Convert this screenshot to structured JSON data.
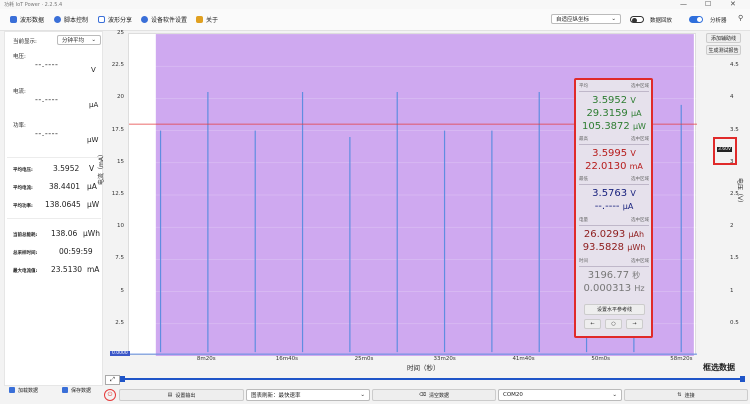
{
  "window": {
    "title": "功耗 IoT Power · 2.2.5.4",
    "controls": [
      "—",
      "☐",
      "✕"
    ]
  },
  "toolbar": {
    "items": [
      {
        "label": "波形数据",
        "color": "#3a6fd8"
      },
      {
        "label": "脚本控制",
        "color": "#3a6fd8"
      },
      {
        "label": "波形分享",
        "color": "#3a6fd8"
      },
      {
        "label": "设备软件设置",
        "color": "#3a6fd8"
      },
      {
        "label": "关于",
        "color": "#e0a020"
      }
    ],
    "range_select": "自适应纵坐标",
    "data_record_label": "数据回放",
    "data_record_on": false,
    "analyze_label": "分析器",
    "analyze_on": true,
    "pin_icon": "pin-icon"
  },
  "left": {
    "display_label": "当前显示:",
    "display_mode": "分钟平均",
    "voltage_label": "电压:",
    "voltage_value": "--.----",
    "voltage_unit": "V",
    "current_label": "电流:",
    "current_value": "--.----",
    "current_unit": "µA",
    "power_label": "功率:",
    "power_value": "--.----",
    "power_unit": "µW",
    "avg_voltage_label": "平均电压:",
    "avg_voltage": "3.5952",
    "avg_voltage_unit": "V",
    "avg_current_label": "平均电流:",
    "avg_current": "38.4401",
    "avg_current_unit": "µA",
    "avg_power_label": "平均功率:",
    "avg_power": "138.0645",
    "avg_power_unit": "µW",
    "total_energy_label": "当前总能耗:",
    "total_energy": "138.06",
    "total_energy_unit": "µWh",
    "run_time_label": "总采样时间:",
    "run_time": "00:59:59",
    "max_current_label": "最大电流值:",
    "max_current": "23.5130",
    "max_current_unit": "mA",
    "load_button": "加载数据",
    "save_button": "保存数据"
  },
  "plot": {
    "ylabel": "电流（mA）",
    "y2label": "电压（V）",
    "xlabel": "时间（秒）",
    "select_label": "框选数据",
    "yticks": [
      "25",
      "22.5",
      "20",
      "17.5",
      "15",
      "12.5",
      "10",
      "7.5",
      "5",
      "2.5"
    ],
    "y2ticks": [
      "4.5",
      "4",
      "3.5",
      "3",
      "2.5",
      "2",
      "1.5",
      "1",
      "0.5"
    ],
    "xticks": [
      "8m20s",
      "16m40s",
      "25m0s",
      "33m20s",
      "41m40s",
      "50m0s",
      "58m20s"
    ],
    "cursor_value": "3.60V",
    "corner_value": "0.0000",
    "side_buttons": [
      "添加辅助线",
      "生成测试报告"
    ],
    "region_color": "#cfa9f0",
    "spike_color": "#5f8de0",
    "hline_color": "#e53b3b"
  },
  "overlay": {
    "avg_title": "平均",
    "avg_right": "选中区域",
    "avg_v": "3.5952",
    "avg_v_unit": "V",
    "avg_i": "29.3159",
    "avg_i_unit": "µA",
    "avg_p": "105.3872",
    "avg_p_unit": "µW",
    "max_title": "最高",
    "max_right": "选中区域",
    "max_v": "3.5995",
    "max_v_unit": "V",
    "max_i": "22.0130",
    "max_i_unit": "mA",
    "min_title": "最低",
    "min_right": "选中区域",
    "min_v": "3.5763",
    "min_v_unit": "V",
    "min_i": "--.----",
    "min_i_unit": "µA",
    "energy_title": "电量",
    "energy_right": "选中区域",
    "charge": "26.0293",
    "charge_unit": "µAh",
    "energy": "93.5828",
    "energy_unit": "µWh",
    "time_title": "时间",
    "time_right": "选中区域",
    "duration": "3196.77",
    "duration_unit": "秒",
    "freq": "0.000313",
    "freq_unit": "Hz",
    "set_ref_button": "设置水平参考线",
    "nav_left": "←",
    "nav_center": "○",
    "nav_right": "→"
  },
  "bottom": {
    "set_output": "设置输出",
    "rate_select": "图表刷新：最快速率",
    "clear_data": "清空数据",
    "port_select": "COM20",
    "connect": "连接"
  },
  "chart_data": {
    "type": "line",
    "xlabel": "时间（秒）",
    "ylabel": "电流（mA）",
    "y2label": "电压（V）",
    "xlim": [
      0,
      3600
    ],
    "ylim": [
      0,
      25
    ],
    "y2lim": [
      0,
      5
    ],
    "series": [
      {
        "x": [
          200,
          500,
          800,
          1100,
          1400,
          1700,
          2000,
          2300,
          2600,
          2900,
          3200,
          3500
        ],
        "values": [
          17.5,
          20.5,
          17.5,
          20.5,
          17.0,
          20.5,
          17.5,
          17.5,
          20.5,
          17.5,
          18.5,
          19.5
        ]
      }
    ],
    "voltage_level": 3.6
  }
}
